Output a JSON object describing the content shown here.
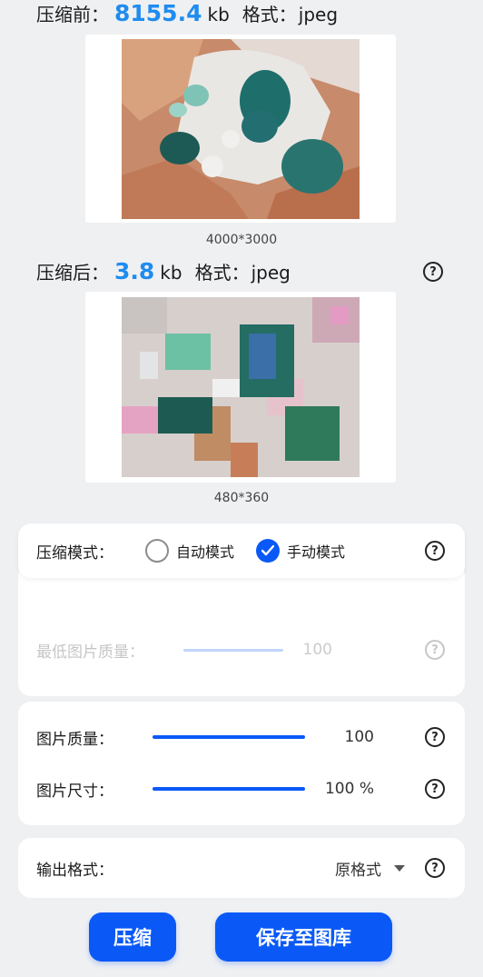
{
  "before": {
    "label": "压缩前：",
    "size": "8155.4",
    "unit": "kb",
    "format_label": "格式：",
    "format": "jpeg",
    "dimensions": "4000*3000"
  },
  "after": {
    "label": "压缩后：",
    "size": "3.8",
    "unit": "kb",
    "format_label": "格式：",
    "format": "jpeg",
    "dimensions": "480*360"
  },
  "mode": {
    "label": "压缩模式：",
    "options": [
      {
        "label": "自动模式",
        "selected": false
      },
      {
        "label": "手动模式",
        "selected": true
      }
    ]
  },
  "auto_settings": {
    "min_quality_label": "最低图片质量：",
    "min_quality_value": "100"
  },
  "manual_settings": {
    "quality_label": "图片质量：",
    "quality_value": "100",
    "size_label": "图片尺寸：",
    "size_value": "100 %"
  },
  "output": {
    "label": "输出格式：",
    "value": "原格式"
  },
  "buttons": {
    "compress": "压缩",
    "save": "保存至图库"
  },
  "help_glyph": "?",
  "colors": {
    "accent": "#0a59f7",
    "size_highlight": "#1f8cf0",
    "background": "#eff0f2"
  }
}
